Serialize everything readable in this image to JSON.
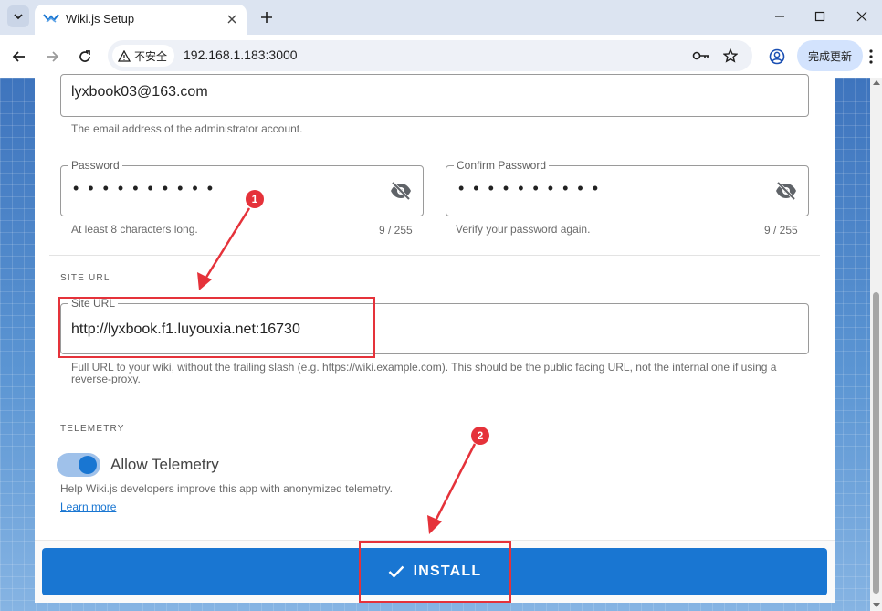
{
  "browser": {
    "tab_title": "Wiki.js Setup",
    "security_label": "不安全",
    "url": "192.168.1.183:3000",
    "update_label": "完成更新"
  },
  "admin": {
    "email_value": "lyxbook03@163.com",
    "email_hint": "The email address of the administrator account.",
    "password_label": "Password",
    "password_dots": "••••••••••",
    "password_hint": "At least 8 characters long.",
    "password_counter": "9 / 255",
    "confirm_label": "Confirm Password",
    "confirm_dots": "••••••••••",
    "confirm_hint": "Verify your password again.",
    "confirm_counter": "9 / 255"
  },
  "site_url": {
    "section_title": "SITE URL",
    "label": "Site URL",
    "value": "http://lyxbook.f1.luyouxia.net:16730",
    "hint": "Full URL to your wiki, without the trailing slash (e.g. https://wiki.example.com). This should be the public facing URL, not the internal one if using a reverse-proxy."
  },
  "telemetry": {
    "section_title": "TELEMETRY",
    "toggle_label": "Allow Telemetry",
    "enabled": true,
    "description": "Help Wiki.js developers improve this app with anonymized telemetry.",
    "learn_more": "Learn more"
  },
  "install": {
    "label": "INSTALL"
  },
  "annotations": {
    "badge_1": "1",
    "badge_2": "2",
    "color": "#e5323a"
  },
  "colors": {
    "primary": "#1976d2",
    "toggle_track": "#9fc1ea"
  }
}
